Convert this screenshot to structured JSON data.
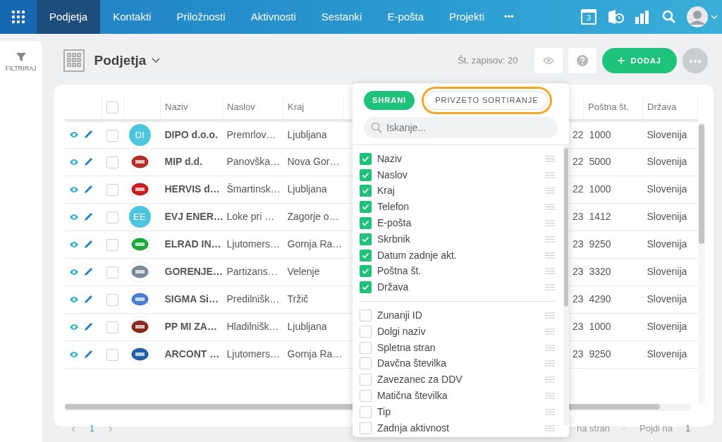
{
  "nav": {
    "tabs": [
      {
        "label": "Podjetja",
        "selected": true
      },
      {
        "label": "Kontakti",
        "selected": false
      },
      {
        "label": "Priložnosti",
        "selected": false
      },
      {
        "label": "Aktivnosti",
        "selected": false
      },
      {
        "label": "Sestanki",
        "selected": false
      },
      {
        "label": "E-pošta",
        "selected": false
      },
      {
        "label": "Projekti",
        "selected": false
      }
    ],
    "more": "•••",
    "calendar_day": "3"
  },
  "sidebar": {
    "filter_label": "FILTRIRAJ"
  },
  "header": {
    "title": "Podjetja",
    "record_count": "Št. zapisov: 20",
    "add_button": "DODAJ"
  },
  "table": {
    "all_selected": false,
    "columns": [
      "Naziv",
      "Naslov",
      "Kraj",
      "Poštna št.",
      "Država"
    ],
    "rows": [
      {
        "selected": false,
        "avatar": {
          "kind": "initials",
          "text": "DI",
          "color": "#4cc6dc"
        },
        "name": "DIPO d.o.o.",
        "address": "Premrlov…",
        "city": "Ljubljana",
        "date_end": "22",
        "postal": "1000",
        "country": "Slovenija"
      },
      {
        "selected": false,
        "avatar": {
          "kind": "logo",
          "color": "#b3302a"
        },
        "name": "MIP d.d.",
        "address": "Panovška…",
        "city": "Nova Gor…",
        "date_end": "22",
        "postal": "5000",
        "country": "Slovenija"
      },
      {
        "selected": false,
        "avatar": {
          "kind": "logo",
          "color": "#c81e1e"
        },
        "name": "HERVIS d…",
        "address": "Šmartinsk…",
        "city": "Ljubljana",
        "date_end": "22",
        "postal": "1000",
        "country": "Slovenija"
      },
      {
        "selected": false,
        "avatar": {
          "kind": "initials",
          "text": "EE",
          "color": "#4cc6dc"
        },
        "name": "EVJ ENER…",
        "address": "Loke pri …",
        "city": "Zagorje o…",
        "date_end": "23",
        "postal": "1412",
        "country": "Slovenija"
      },
      {
        "selected": false,
        "avatar": {
          "kind": "logo",
          "color": "#1fa83a"
        },
        "name": "ELRAD IN…",
        "address": "Ljutomers…",
        "city": "Gornja Ra…",
        "date_end": "23",
        "postal": "9250",
        "country": "Slovenija"
      },
      {
        "selected": false,
        "avatar": {
          "kind": "logo",
          "color": "#7a8a99"
        },
        "name": "GORENJE…",
        "address": "Partizans…",
        "city": "Velenje",
        "date_end": "23",
        "postal": "3320",
        "country": "Slovenija"
      },
      {
        "selected": false,
        "avatar": {
          "kind": "logo",
          "color": "#4a7fd0"
        },
        "name": "SIGMA Si…",
        "address": "Predilnišk…",
        "city": "Tržič",
        "date_end": "23",
        "postal": "4290",
        "country": "Slovenija"
      },
      {
        "selected": false,
        "avatar": {
          "kind": "logo",
          "color": "#8a2a1e"
        },
        "name": "PP MI ZA…",
        "address": "Hladilnišk…",
        "city": "Ljubljana",
        "date_end": "23",
        "postal": "1000",
        "country": "Slovenija"
      },
      {
        "selected": false,
        "avatar": {
          "kind": "logo",
          "color": "#1d5fa8"
        },
        "name": "ARCONT …",
        "address": "Ljutomers…",
        "city": "Gornja Ra…",
        "date_end": "23",
        "postal": "9250",
        "country": "Slovenija"
      }
    ]
  },
  "pagination": {
    "prev": "‹",
    "pages": [
      {
        "label": "1",
        "selected": true
      }
    ],
    "next": "›",
    "per_page_label": "na stran",
    "goto_label": "Pojdi na",
    "goto_value": "1"
  },
  "column_panel": {
    "save_button": "SHRANI",
    "reset_button": {
      "label": "PRIVZETO SORTIRANJE",
      "highlighted": true
    },
    "search_placeholder": "Iskanje...",
    "columns": [
      {
        "label": "Naziv",
        "checked": true
      },
      {
        "label": "Naslov",
        "checked": true
      },
      {
        "label": "Kraj",
        "checked": true
      },
      {
        "label": "Telefon",
        "checked": true
      },
      {
        "label": "E-pošta",
        "checked": true
      },
      {
        "label": "Skrbnik",
        "checked": true
      },
      {
        "label": "Datum zadnje akt.",
        "checked": true
      },
      {
        "label": "Poštna št.",
        "checked": true
      },
      {
        "label": "Država",
        "checked": true
      },
      {
        "label": "Zunanji ID",
        "checked": false
      },
      {
        "label": "Dolgi naziv",
        "checked": false
      },
      {
        "label": "Spletna stran",
        "checked": false
      },
      {
        "label": "Davčna številka",
        "checked": false
      },
      {
        "label": "Zavezanec za DDV",
        "checked": false
      },
      {
        "label": "Matična številka",
        "checked": false
      },
      {
        "label": "Tip",
        "checked": false
      },
      {
        "label": "Zadnja aktivnost",
        "checked": false
      }
    ]
  }
}
